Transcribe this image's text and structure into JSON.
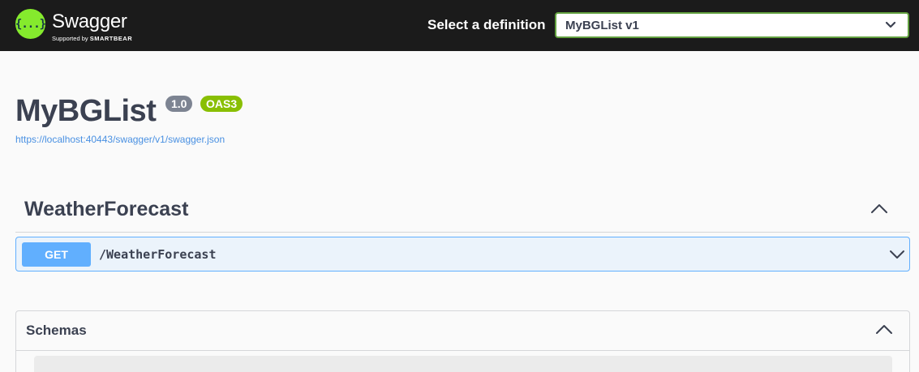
{
  "topbar": {
    "logo_glyph": "{...}",
    "brand": "Swagger",
    "brand_supported_by": "Supported by",
    "brand_company": "SMARTBEAR",
    "definition_label": "Select a definition",
    "definition_selected": "MyBGList v1",
    "accent_color": "#85ea2d"
  },
  "info": {
    "title": "MyBGList",
    "version_badge": "1.0",
    "oas_badge": "OAS3",
    "spec_url": "https://localhost:40443/swagger/v1/swagger.json"
  },
  "tags": [
    {
      "name": "WeatherForecast",
      "expanded": true,
      "operations": [
        {
          "method": "GET",
          "path": "/WeatherForecast",
          "method_color": "#61affe"
        }
      ]
    }
  ],
  "schemas": {
    "title": "Schemas",
    "expanded": true
  },
  "icons": {
    "select_chevron": "chevron-down-icon",
    "tag_toggle": "chevron-up-icon",
    "operation_toggle": "chevron-down-icon",
    "schemas_toggle": "chevron-up-icon"
  }
}
